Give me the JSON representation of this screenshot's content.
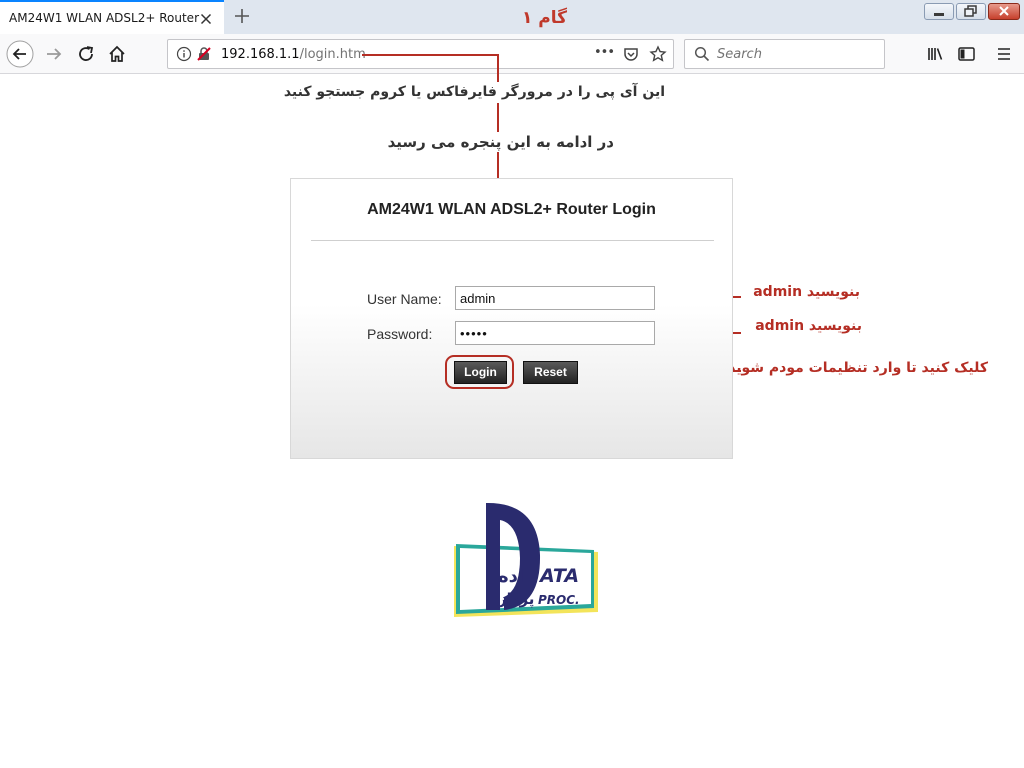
{
  "browser": {
    "tab_title": "AM24W1 WLAN ADSL2+ Router",
    "url_host": "192.168.1.1",
    "url_path": "/login.htm",
    "search_placeholder": "Search",
    "page_actions_glyph": "•••"
  },
  "annotations": {
    "step_title": "گام ۱",
    "ip_instruction": "این آی پی را در مرورگر فایرفاکس یا کروم جستجو کنید",
    "window_instruction": "در ادامه به این پنجره می رسید",
    "username_hint": "بنویسید admin",
    "password_hint": "بنویسید admin",
    "login_hint": "کلیک کنید تا وارد تنظیمات مودم شوید"
  },
  "login": {
    "title": "AM24W1 WLAN ADSL2+ Router Login",
    "username_label": "User Name:",
    "username_value": "admin",
    "password_label": "Password:",
    "password_value": "admin",
    "login_button": "Login",
    "reset_button": "Reset"
  },
  "logo": {
    "latin_text": "ATA",
    "latin_sub": "PROC.",
    "persian_top": "اده",
    "persian_bottom": "پرداز"
  },
  "colors": {
    "annotation_red": "#b52e24",
    "logo_navy": "#2a2b6e",
    "logo_teal": "#2aa79b",
    "logo_yellow": "#f3e45a"
  },
  "icons": {
    "back": "arrow-left-icon",
    "forward": "arrow-right-icon",
    "reload": "reload-icon",
    "home": "home-icon",
    "info": "info-icon",
    "insecure": "insecure-lock-icon",
    "pocket": "pocket-icon",
    "bookmark": "star-icon",
    "library": "library-icon",
    "sidebar": "sidebar-icon",
    "menu": "hamburger-menu-icon"
  }
}
